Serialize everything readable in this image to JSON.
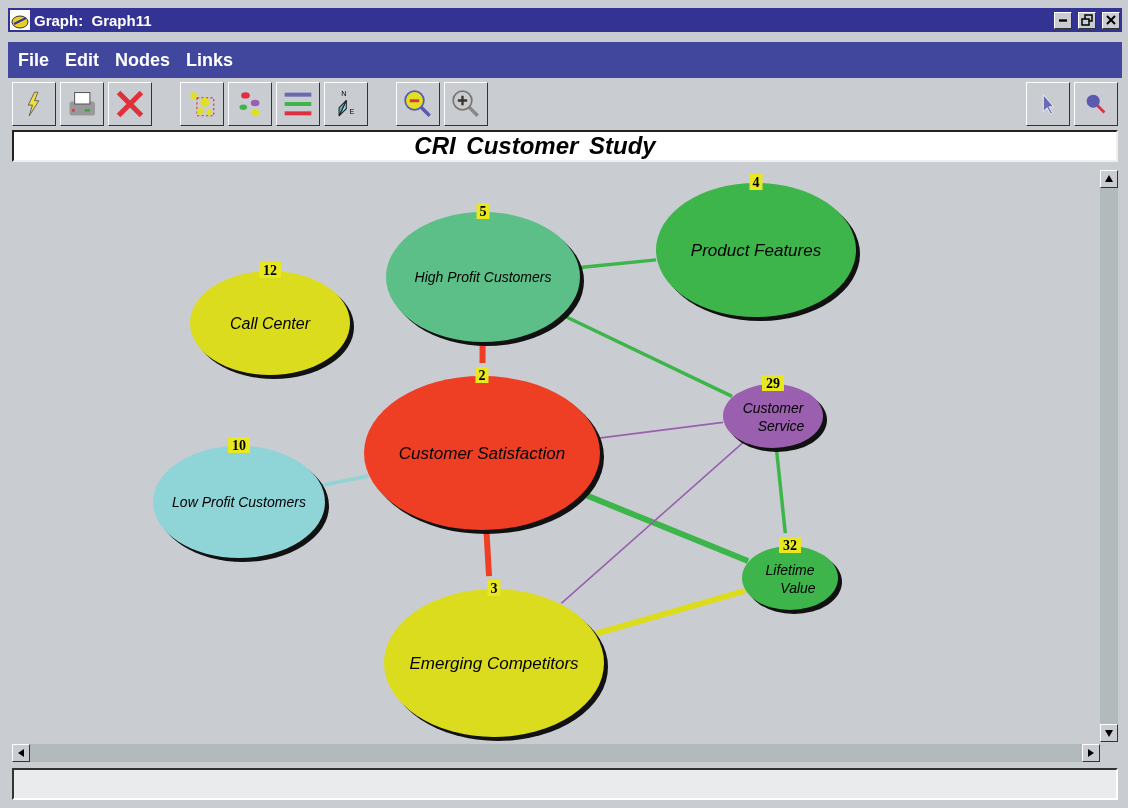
{
  "window": {
    "title": "Graph:  Graph11"
  },
  "menu": [
    "File",
    "Edit",
    "Nodes",
    "Links"
  ],
  "graph_title": "CRI Customer Study",
  "nodes": [
    {
      "label_lines": [
        "High Profit Customers"
      ],
      "badge": "5",
      "color": "#5cbf88"
    },
    {
      "label_lines": [
        "Product Features"
      ],
      "badge": "4",
      "color": "#3db54b"
    },
    {
      "label_lines": [
        "Call Center"
      ],
      "badge": "12",
      "color": "#dcdc1f"
    },
    {
      "label_lines": [
        "Customer Satisfaction"
      ],
      "badge": "2",
      "color": "#ee3e24"
    },
    {
      "label_lines": [
        "Customer",
        "Service"
      ],
      "badge": "29",
      "color": "#9a5fae"
    },
    {
      "label_lines": [
        "Low Profit Customers"
      ],
      "badge": "10",
      "color": "#8fd4d7"
    },
    {
      "label_lines": [
        "Lifetime",
        "Value"
      ],
      "badge": "32",
      "color": "#3db54b"
    },
    {
      "label_lines": [
        "Emerging Competitors"
      ],
      "badge": "3",
      "color": "#dcdc1f"
    }
  ],
  "links": [
    {
      "color": "#3db54b",
      "kind": "medium"
    },
    {
      "color": "#ee3e24",
      "kind": "thick"
    },
    {
      "color": "#3db54b",
      "kind": "medium"
    },
    {
      "color": "#8fd4d7",
      "kind": "medium"
    },
    {
      "color": "#9a5fae",
      "kind": "thin"
    },
    {
      "color": "#3db54b",
      "kind": "thick"
    },
    {
      "color": "#ee3e24",
      "kind": "thick"
    },
    {
      "color": "#9a5fae",
      "kind": "thin"
    },
    {
      "color": "#dcdc1f",
      "kind": "thick"
    },
    {
      "color": "#3db54b",
      "kind": "medium"
    }
  ],
  "compass_labels": [
    "N",
    "E"
  ]
}
